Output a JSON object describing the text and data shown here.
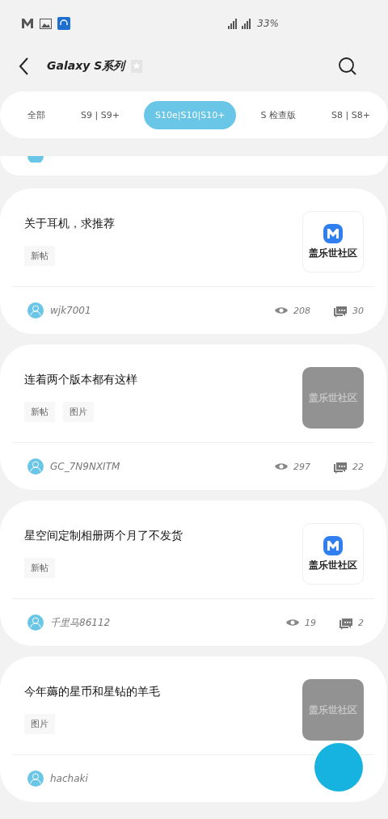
{
  "status_bar": {
    "battery": "33%"
  },
  "header": {
    "title": "Galaxy S系列",
    "favorited": false
  },
  "tabs": [
    {
      "label": "全部",
      "selected": false
    },
    {
      "label": "S9 | S9+",
      "selected": false
    },
    {
      "label": "S10e|S10|S10+",
      "selected": true
    },
    {
      "label": "S 检查版",
      "selected": false
    },
    {
      "label": "S8 | S8+",
      "selected": false
    }
  ],
  "posts": [
    {
      "title": "关于耳机，求推荐",
      "tags": [
        "新帖"
      ],
      "thumbnail": {
        "kind": "logo",
        "label": "盖乐世社区"
      },
      "author": "wjk7001",
      "views": "208",
      "comments": "30"
    },
    {
      "title": "连着两个版本都有这样",
      "tags": [
        "新帖",
        "图片"
      ],
      "thumbnail": {
        "kind": "placeholder",
        "label": "盖乐世社区"
      },
      "author": "GC_7N9NXITM",
      "views": "297",
      "comments": "22"
    },
    {
      "title": "星空间定制相册两个月了不发货",
      "tags": [
        "新帖"
      ],
      "thumbnail": {
        "kind": "logo",
        "label": "盖乐世社区"
      },
      "author": "千里马86112",
      "views": "19",
      "comments": "2"
    },
    {
      "title": "今年薅的星币和星钻的羊毛",
      "tags": [
        "图片"
      ],
      "thumbnail": {
        "kind": "placeholder",
        "label": "盖乐世社区"
      },
      "author": "hachaki"
    }
  ]
}
